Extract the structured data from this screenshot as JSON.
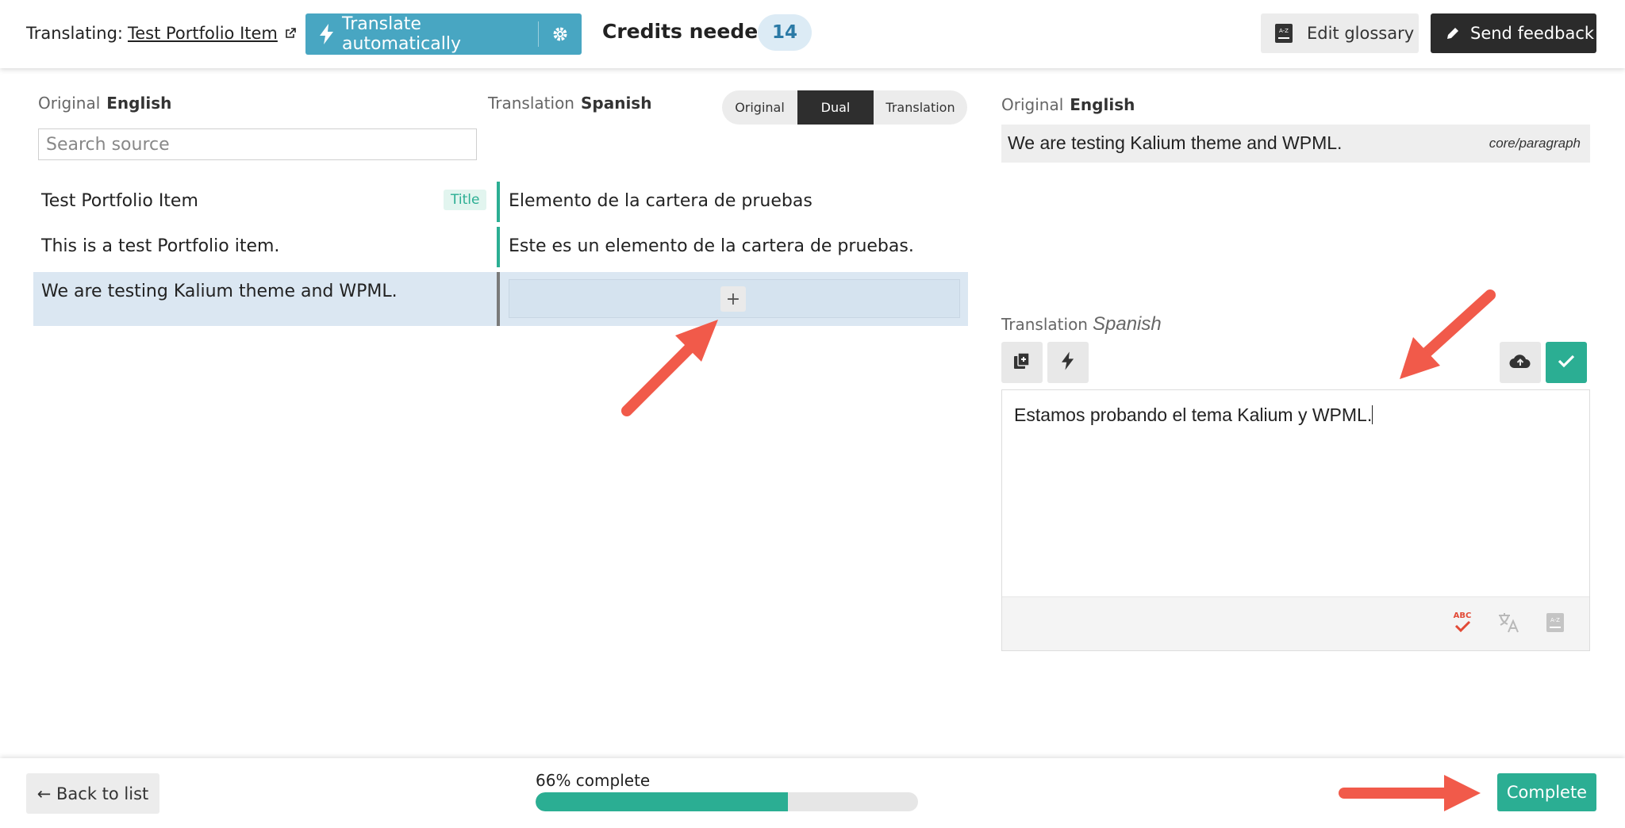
{
  "header": {
    "translating_label": "Translating:",
    "item_title": "Test Portfolio Item",
    "auto_translate_label": "Translate automatically",
    "credits_label": "Credits needed",
    "credits_value": "14",
    "glossary_label": "Edit glossary",
    "feedback_label": "Send feedback"
  },
  "left": {
    "original_label": "Original",
    "original_lang": "English",
    "translation_label": "Translation",
    "translation_lang": "Spanish",
    "search_placeholder": "Search source",
    "view_modes": [
      "Original",
      "Dual",
      "Translation"
    ],
    "active_view": "Dual",
    "rows": [
      {
        "source": "Test Portfolio Item",
        "tag": "Title",
        "translation": "Elemento de la cartera de pruebas"
      },
      {
        "source": "This is a test Portfolio item.",
        "translation": "Este es un elemento de la cartera de pruebas."
      },
      {
        "source": "We are testing Kalium theme and WPML.",
        "translation": "",
        "active": true
      }
    ],
    "add_symbol": "+"
  },
  "right": {
    "original_label": "Original",
    "original_lang": "English",
    "original_text": "We are testing Kalium theme and WPML.",
    "block_type": "core/paragraph",
    "translation_label": "Translation",
    "translation_lang": "Spanish",
    "editor_text": "Estamos probando el tema Kalium y WPML.",
    "spellcheck_label": "ABC"
  },
  "footer": {
    "back_label": "← Back to list",
    "progress_label": "66% complete",
    "progress_fraction": 0.66,
    "complete_label": "Complete"
  },
  "colors": {
    "accent_green": "#2bae93",
    "auto_blue": "#48a6c2",
    "arrow_red": "#f15a4a"
  }
}
